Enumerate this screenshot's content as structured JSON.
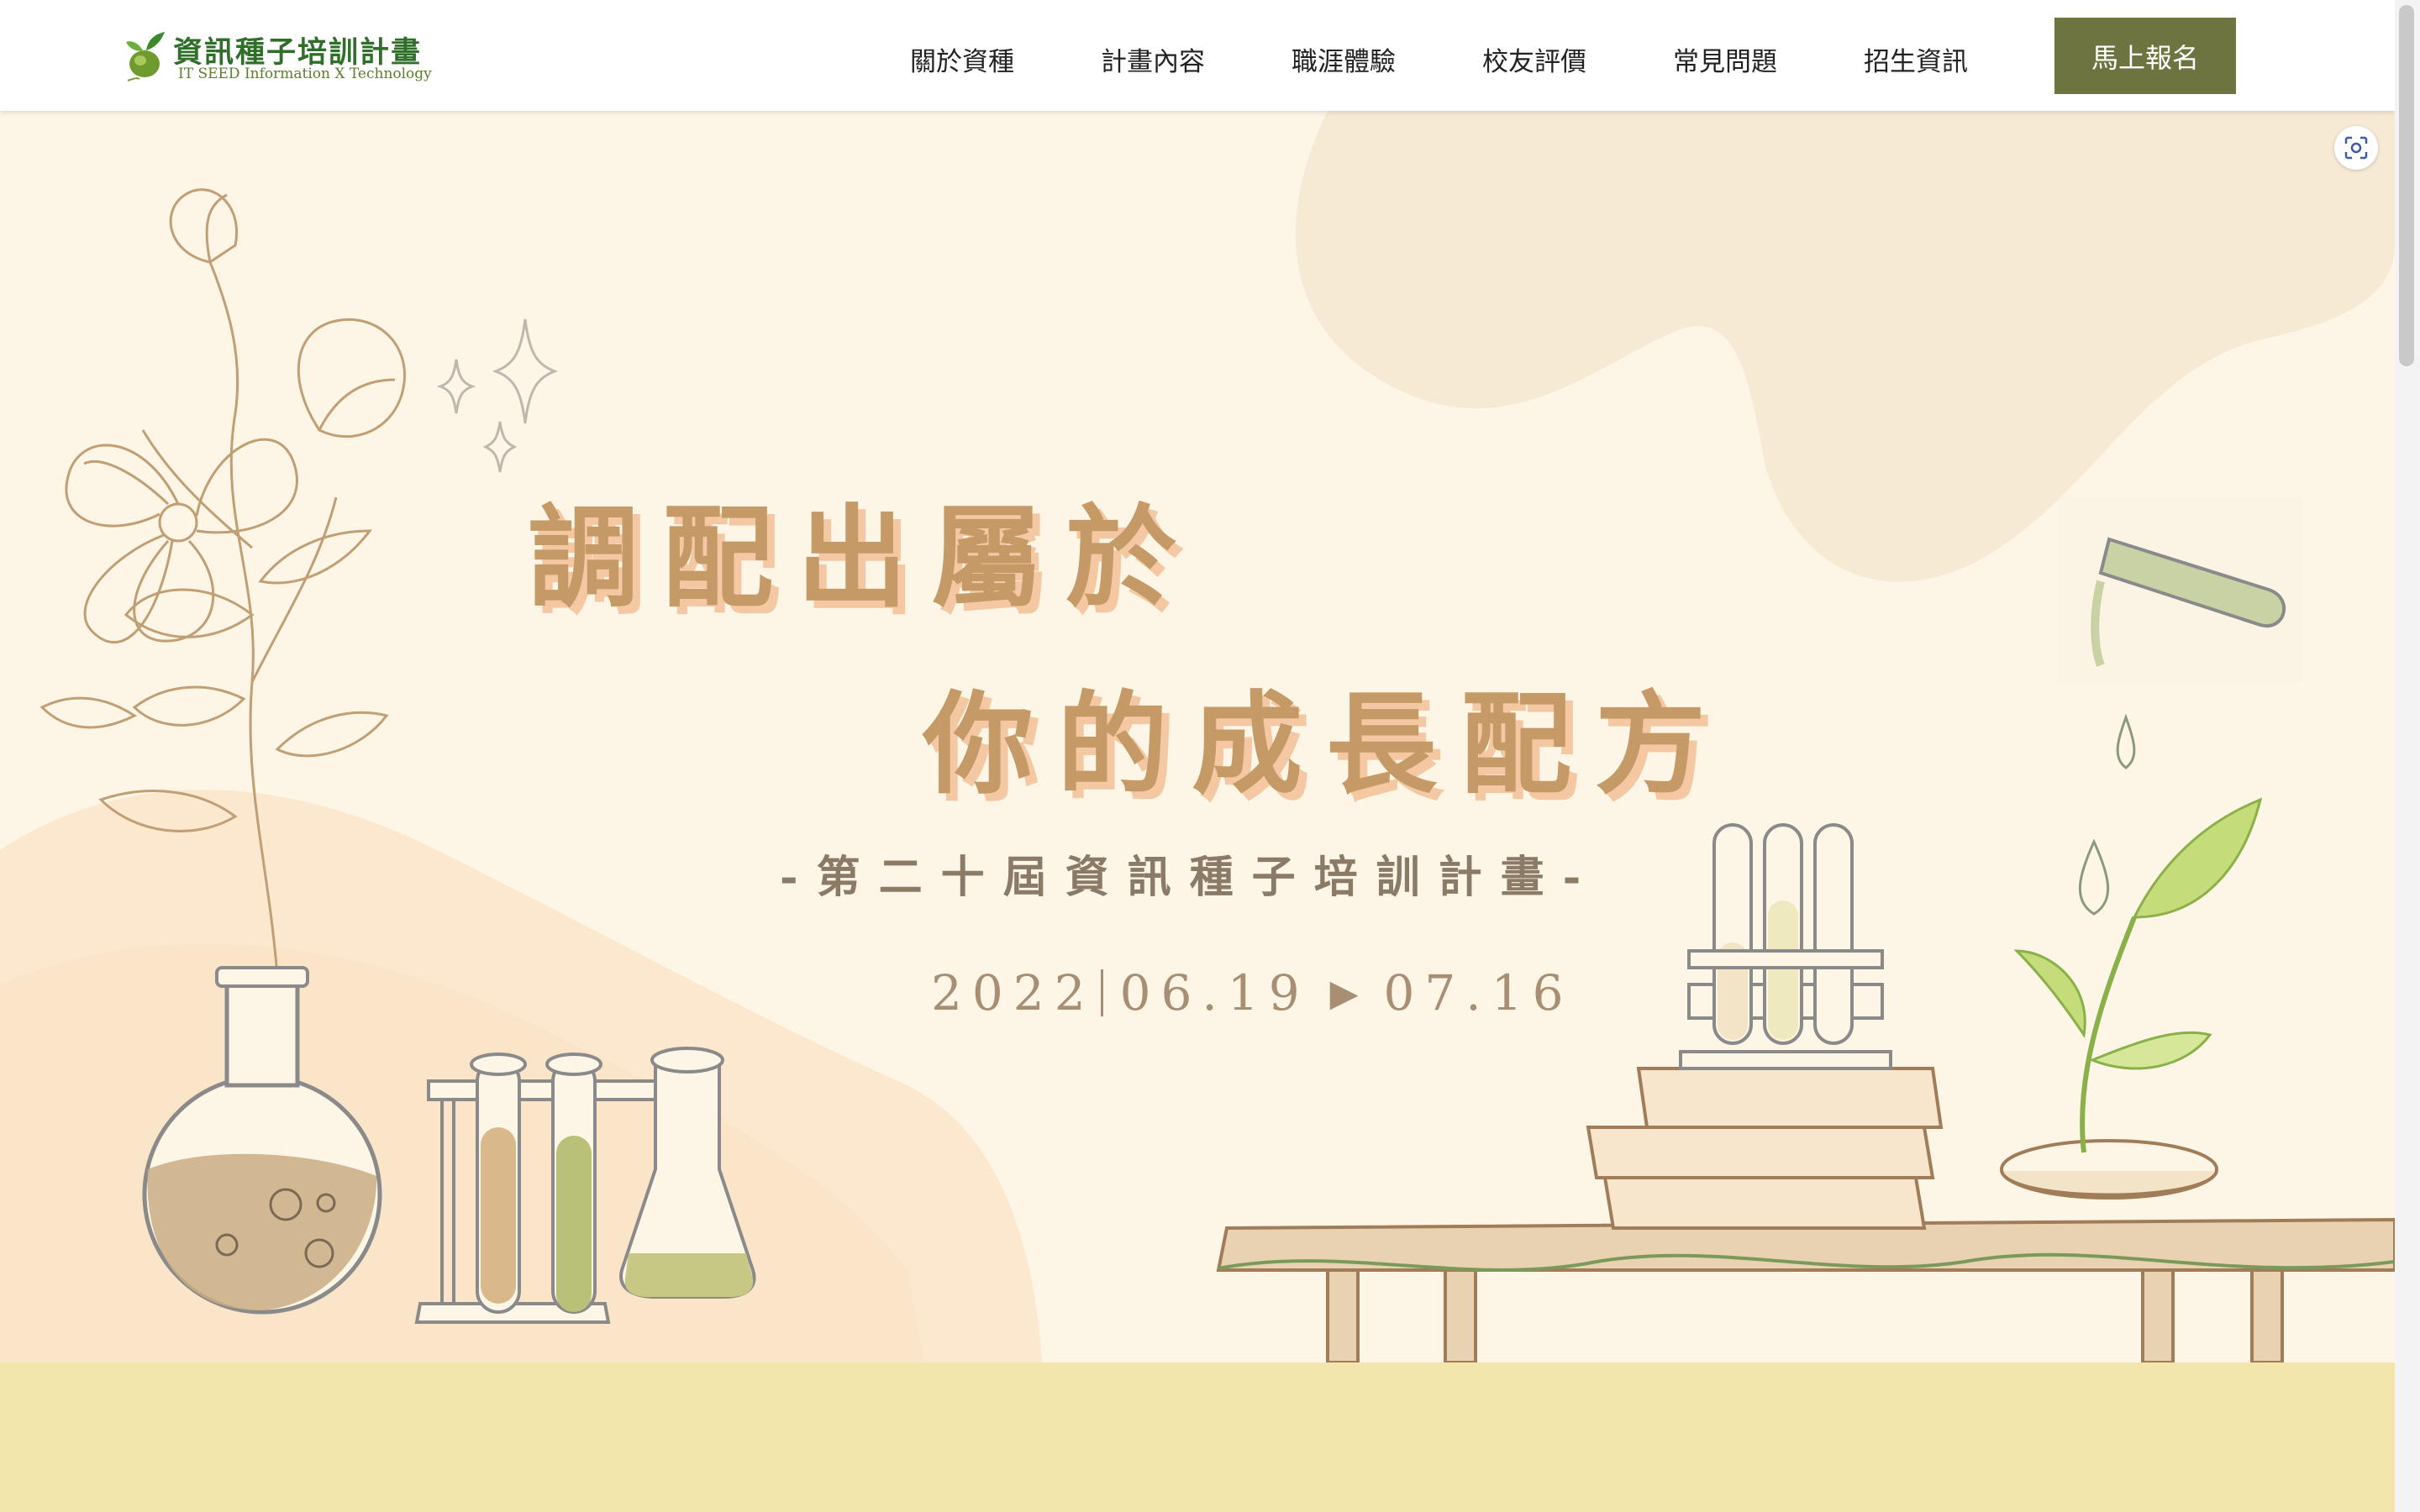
{
  "header": {
    "logo": {
      "title": "資訊種子培訓計畫",
      "subtitle": "IT SEED  Information X Technology",
      "icon": "seed-sprout-icon"
    },
    "nav": [
      "關於資種",
      "計畫內容",
      "職涯體驗",
      "校友評價",
      "常見問題",
      "招生資訊"
    ],
    "cta_label": "馬上報名"
  },
  "hero": {
    "headline_line1": "調配出屬於",
    "headline_line2": "你的成長配方",
    "subtitle": "-第二十屆資訊種子培訓計畫-",
    "date_year": "2022",
    "date_start": "06.19",
    "date_end": "07.16",
    "arrow_icon": "play-arrow-icon"
  },
  "floating": {
    "icon": "screen-capture-icon"
  },
  "colors": {
    "background": "#fdf6e6",
    "cta": "#6e7440",
    "headline": "#c59a66",
    "headline_shadow": "#f4c8a2",
    "band": "#f3e6ad"
  }
}
